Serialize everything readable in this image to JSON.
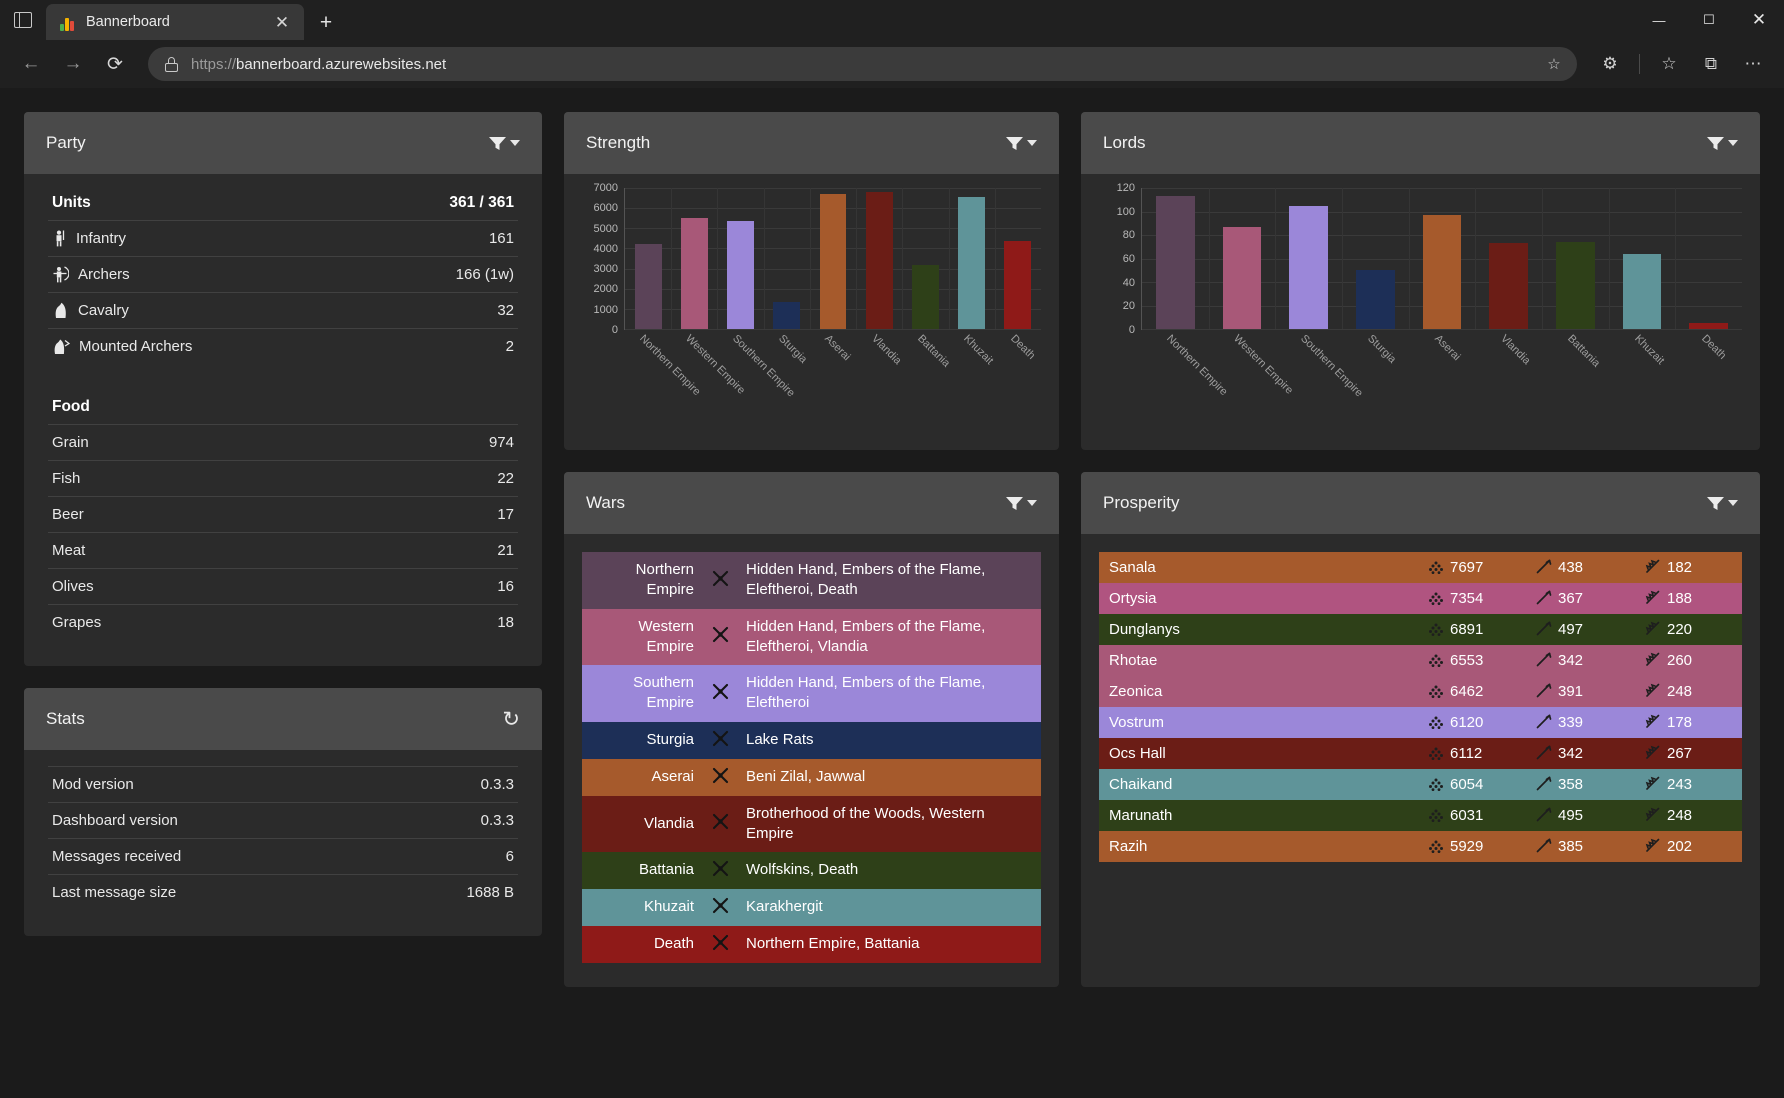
{
  "browser": {
    "tab_title": "Bannerboard",
    "favicon_icon": "bar-chart-favicon",
    "new_tab_label": "+",
    "close_tab_label": "✕",
    "back_label": "←",
    "forward_label": "→",
    "reload_label": "⟳",
    "url_scheme": "https://",
    "url_host": "bannerboard.azurewebsites.net",
    "minimize_label": "—",
    "maximize_label": "☐",
    "close_label": "✕",
    "favorite_label": "☆",
    "extensions_label": "⚙",
    "collections_label": "⧉",
    "more_label": "⋯"
  },
  "cards": {
    "strength_title": "Strength",
    "lords_title": "Lords",
    "party_title": "Party",
    "wars_title": "Wars",
    "prosperity_title": "Prosperity",
    "stats_title": "Stats"
  },
  "chart_data": [
    {
      "type": "bar",
      "title": "Strength",
      "xlabel": "",
      "ylabel": "",
      "ylim": [
        0,
        7000
      ],
      "yticks": [
        0,
        1000,
        2000,
        3000,
        4000,
        5000,
        6000,
        7000
      ],
      "grid": true,
      "legend": "none",
      "categories": [
        "Northern Empire",
        "Western Empire",
        "Southern Empire",
        "Sturgia",
        "Aserai",
        "Vlandia",
        "Battania",
        "Khuzait",
        "Death"
      ],
      "values": [
        4240,
        5520,
        5360,
        1350,
        6680,
        6780,
        3180,
        6540,
        4360
      ],
      "colors": [
        "#5b4358",
        "#a85878",
        "#9b87d9",
        "#1d2f57",
        "#a65a2c",
        "#6b1d16",
        "#2e4018",
        "#5f9499",
        "#8f1a18"
      ]
    },
    {
      "type": "bar",
      "title": "Lords",
      "xlabel": "",
      "ylabel": "",
      "ylim": [
        0,
        120
      ],
      "yticks": [
        0,
        20,
        40,
        60,
        80,
        100,
        120
      ],
      "grid": true,
      "legend": "none",
      "categories": [
        "Northern Empire",
        "Western Empire",
        "Southern Empire",
        "Sturgia",
        "Aserai",
        "Vlandia",
        "Battania",
        "Khuzait",
        "Death"
      ],
      "values": [
        113,
        87,
        105,
        50,
        97,
        73,
        74,
        64,
        5
      ],
      "colors": [
        "#5b4358",
        "#a85878",
        "#9b87d9",
        "#1d2f57",
        "#a65a2c",
        "#6b1d16",
        "#2e4018",
        "#5f9499",
        "#8f1a18"
      ]
    }
  ],
  "wars": {
    "icon": "crossed-swords-icon",
    "rows": [
      {
        "faction": "Northern Empire",
        "enemies": "Hidden Hand, Embers of the Flame, Eleftheroi, Death",
        "color": "#5b4358"
      },
      {
        "faction": "Western Empire",
        "enemies": "Hidden Hand, Embers of the Flame, Eleftheroi, Vlandia",
        "color": "#a85878"
      },
      {
        "faction": "Southern Empire",
        "enemies": "Hidden Hand, Embers of the Flame, Eleftheroi",
        "color": "#9b87d9"
      },
      {
        "faction": "Sturgia",
        "enemies": "Lake Rats",
        "color": "#1d2f57"
      },
      {
        "faction": "Aserai",
        "enemies": "Beni Zilal, Jawwal",
        "color": "#a65a2c"
      },
      {
        "faction": "Vlandia",
        "enemies": "Brotherhood of the Woods, Western Empire",
        "color": "#6b1d16"
      },
      {
        "faction": "Battania",
        "enemies": "Wolfskins, Death",
        "color": "#2e4018"
      },
      {
        "faction": "Khuzait",
        "enemies": "Karakhergit",
        "color": "#5f9499"
      },
      {
        "faction": "Death",
        "enemies": "Northern Empire, Battania",
        "color": "#8f1a18"
      }
    ]
  },
  "prosperity": {
    "icons": {
      "prosperity": "crowd-icon",
      "production": "hammer-icon",
      "food": "wheat-icon"
    },
    "rows": [
      {
        "name": "Sanala",
        "prosperity": "7697",
        "production": "438",
        "food": "182",
        "color": "#a65a2c"
      },
      {
        "name": "Ortysia",
        "prosperity": "7354",
        "production": "367",
        "food": "188",
        "color": "#b05480"
      },
      {
        "name": "Dunglanys",
        "prosperity": "6891",
        "production": "497",
        "food": "220",
        "color": "#2e4018"
      },
      {
        "name": "Rhotae",
        "prosperity": "6553",
        "production": "342",
        "food": "260",
        "color": "#a85878"
      },
      {
        "name": "Zeonica",
        "prosperity": "6462",
        "production": "391",
        "food": "248",
        "color": "#a85878"
      },
      {
        "name": "Vostrum",
        "prosperity": "6120",
        "production": "339",
        "food": "178",
        "color": "#9b87d9"
      },
      {
        "name": "Ocs Hall",
        "prosperity": "6112",
        "production": "342",
        "food": "267",
        "color": "#6b1d16"
      },
      {
        "name": "Chaikand",
        "prosperity": "6054",
        "production": "358",
        "food": "243",
        "color": "#5f9499"
      },
      {
        "name": "Marunath",
        "prosperity": "6031",
        "production": "495",
        "food": "248",
        "color": "#2e4018"
      },
      {
        "name": "Razih",
        "prosperity": "5929",
        "production": "385",
        "food": "202",
        "color": "#a65a2c"
      }
    ]
  },
  "party": {
    "units_header": "Units",
    "units_total": "361 / 361",
    "units": [
      {
        "label": "Infantry",
        "value": "161",
        "icon": "infantry-icon"
      },
      {
        "label": "Archers",
        "value": "166 (1w)",
        "icon": "archer-icon"
      },
      {
        "label": "Cavalry",
        "value": "32",
        "icon": "cavalry-icon"
      },
      {
        "label": "Mounted Archers",
        "value": "2",
        "icon": "mounted-archer-icon"
      }
    ],
    "food_header": "Food",
    "food": [
      {
        "label": "Grain",
        "value": "974"
      },
      {
        "label": "Fish",
        "value": "22"
      },
      {
        "label": "Beer",
        "value": "17"
      },
      {
        "label": "Meat",
        "value": "21"
      },
      {
        "label": "Olives",
        "value": "16"
      },
      {
        "label": "Grapes",
        "value": "18"
      }
    ]
  },
  "stats": {
    "refresh_icon": "refresh-icon",
    "rows": [
      {
        "label": "Mod version",
        "value": "0.3.3"
      },
      {
        "label": "Dashboard version",
        "value": "0.3.3"
      },
      {
        "label": "Messages received",
        "value": "6"
      },
      {
        "label": "Last message size",
        "value": "1688 B"
      }
    ]
  },
  "theme": {
    "page_bg": "#1b1b1b",
    "card_bg": "#2b2b2b",
    "card_head_bg": "#4a4a4a",
    "text": "#f2f2f2"
  }
}
